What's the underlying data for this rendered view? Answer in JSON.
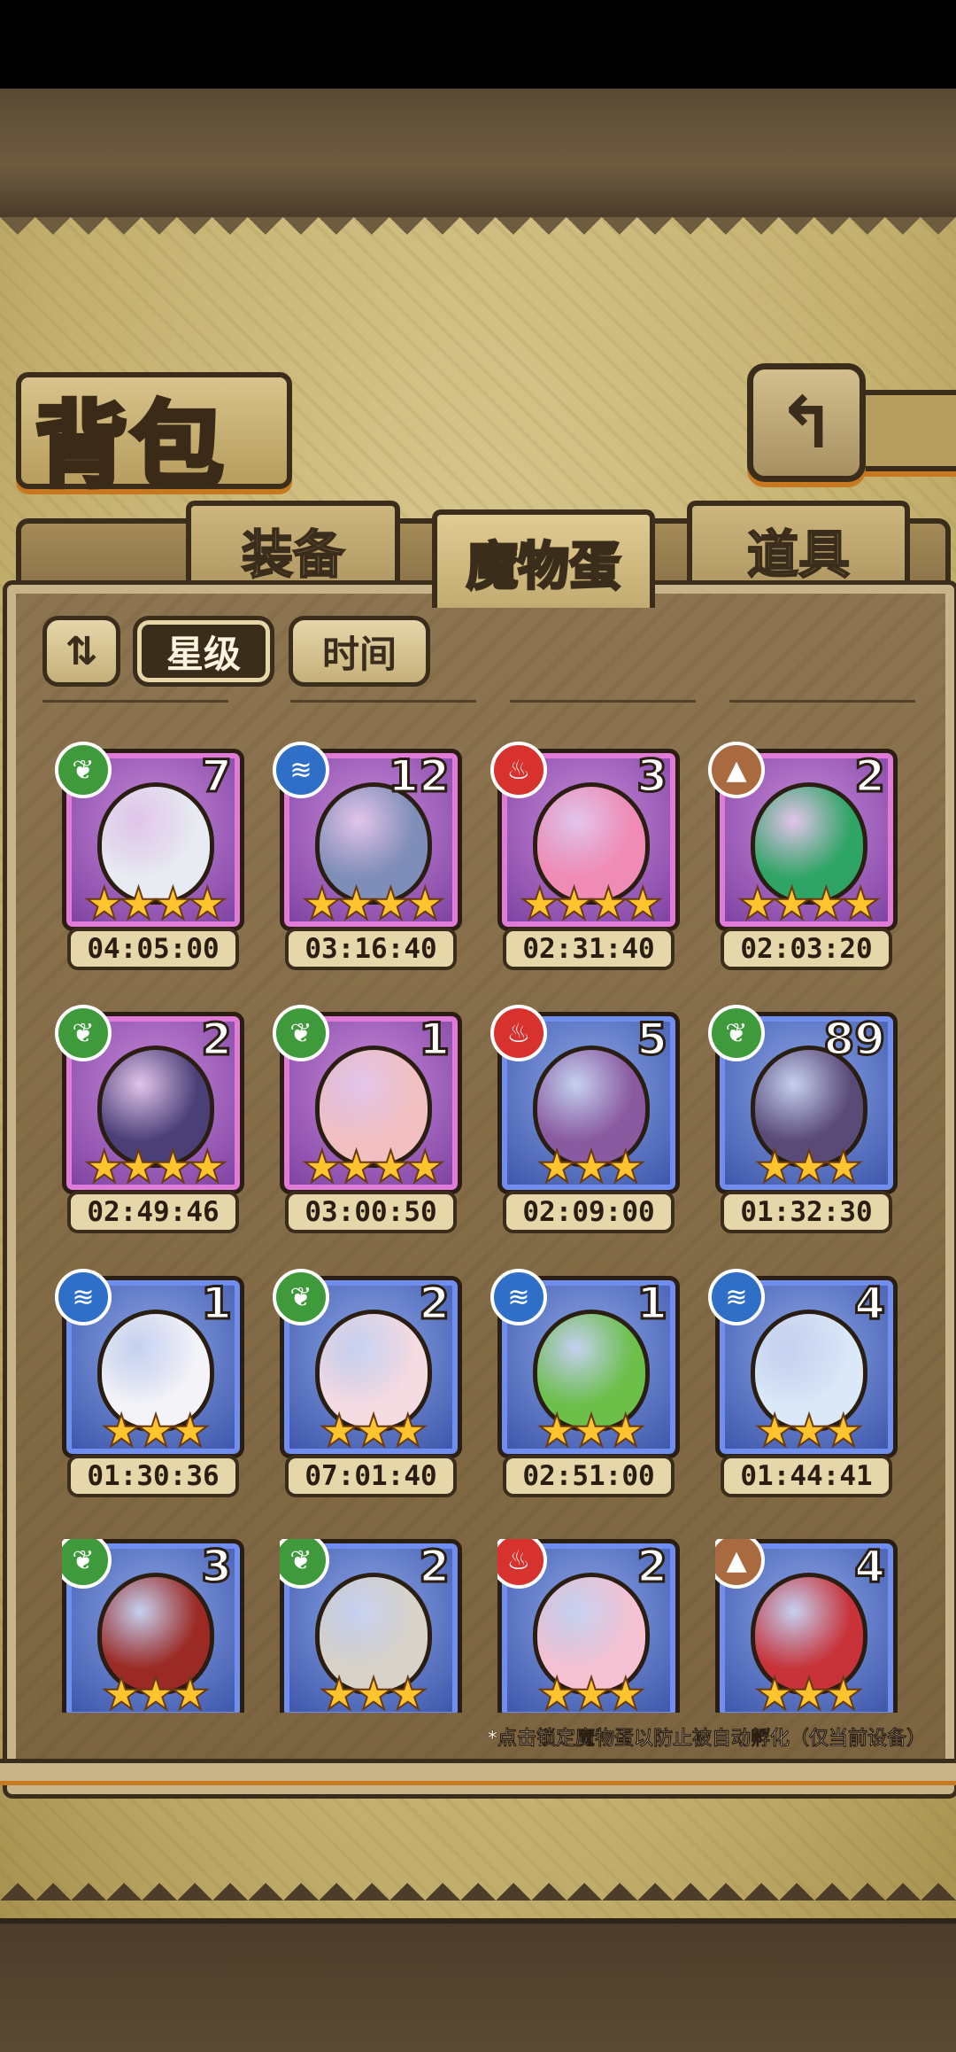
{
  "title": "背包",
  "tabs": [
    {
      "label": "装备",
      "active": false
    },
    {
      "label": "魔物蛋",
      "active": true
    },
    {
      "label": "道具",
      "active": false
    }
  ],
  "sort": {
    "toggle_label": "⇅",
    "star_label": "星级",
    "time_label": "时间"
  },
  "eggs": [
    {
      "element": "nature",
      "count": "7",
      "stars": "★★★★",
      "timer": "04:05:00",
      "rarity": "purple",
      "color": "#e8ecf2"
    },
    {
      "element": "water",
      "count": "12",
      "stars": "★★★★",
      "timer": "03:16:40",
      "rarity": "purple",
      "color": "#7f8eb8"
    },
    {
      "element": "fire",
      "count": "3",
      "stars": "★★★★",
      "timer": "02:31:40",
      "rarity": "purple",
      "color": "#f08bb5"
    },
    {
      "element": "earth",
      "count": "2",
      "stars": "★★★★",
      "timer": "02:03:20",
      "rarity": "purple",
      "color": "#2fa565"
    },
    {
      "element": "nature",
      "count": "2",
      "stars": "★★★★",
      "timer": "02:49:46",
      "rarity": "purple",
      "color": "#4b3f78"
    },
    {
      "element": "nature",
      "count": "1",
      "stars": "★★★★",
      "timer": "03:00:50",
      "rarity": "purple",
      "color": "#f2c0c2"
    },
    {
      "element": "fire",
      "count": "5",
      "stars": "★★★",
      "timer": "02:09:00",
      "rarity": "blue",
      "color": "#8a5aa0"
    },
    {
      "element": "nature",
      "count": "89",
      "stars": "★★★",
      "timer": "01:32:30",
      "rarity": "blue",
      "color": "#5a4a78"
    },
    {
      "element": "water",
      "count": "1",
      "stars": "★★★",
      "timer": "01:30:36",
      "rarity": "blue",
      "color": "#f4f4f8"
    },
    {
      "element": "nature",
      "count": "2",
      "stars": "★★★",
      "timer": "07:01:40",
      "rarity": "blue",
      "color": "#f5dbe2"
    },
    {
      "element": "water",
      "count": "1",
      "stars": "★★★",
      "timer": "02:51:00",
      "rarity": "blue",
      "color": "#6cc04a"
    },
    {
      "element": "water",
      "count": "4",
      "stars": "★★★",
      "timer": "01:44:41",
      "rarity": "blue",
      "color": "#dbe8f8"
    },
    {
      "element": "nature",
      "count": "3",
      "stars": "★★★",
      "timer": "",
      "rarity": "blue",
      "color": "#9b2a24"
    },
    {
      "element": "nature",
      "count": "2",
      "stars": "★★★",
      "timer": "",
      "rarity": "blue",
      "color": "#d8d2c8"
    },
    {
      "element": "fire",
      "count": "2",
      "stars": "★★★",
      "timer": "",
      "rarity": "blue",
      "color": "#f4c2d2"
    },
    {
      "element": "earth",
      "count": "4",
      "stars": "★★★",
      "timer": "",
      "rarity": "blue",
      "color": "#c8333a"
    }
  ],
  "footnote": "*点击锁定魔物蛋以防止被自动孵化（仅当前设备）",
  "back_icon": "back-arrow-icon"
}
